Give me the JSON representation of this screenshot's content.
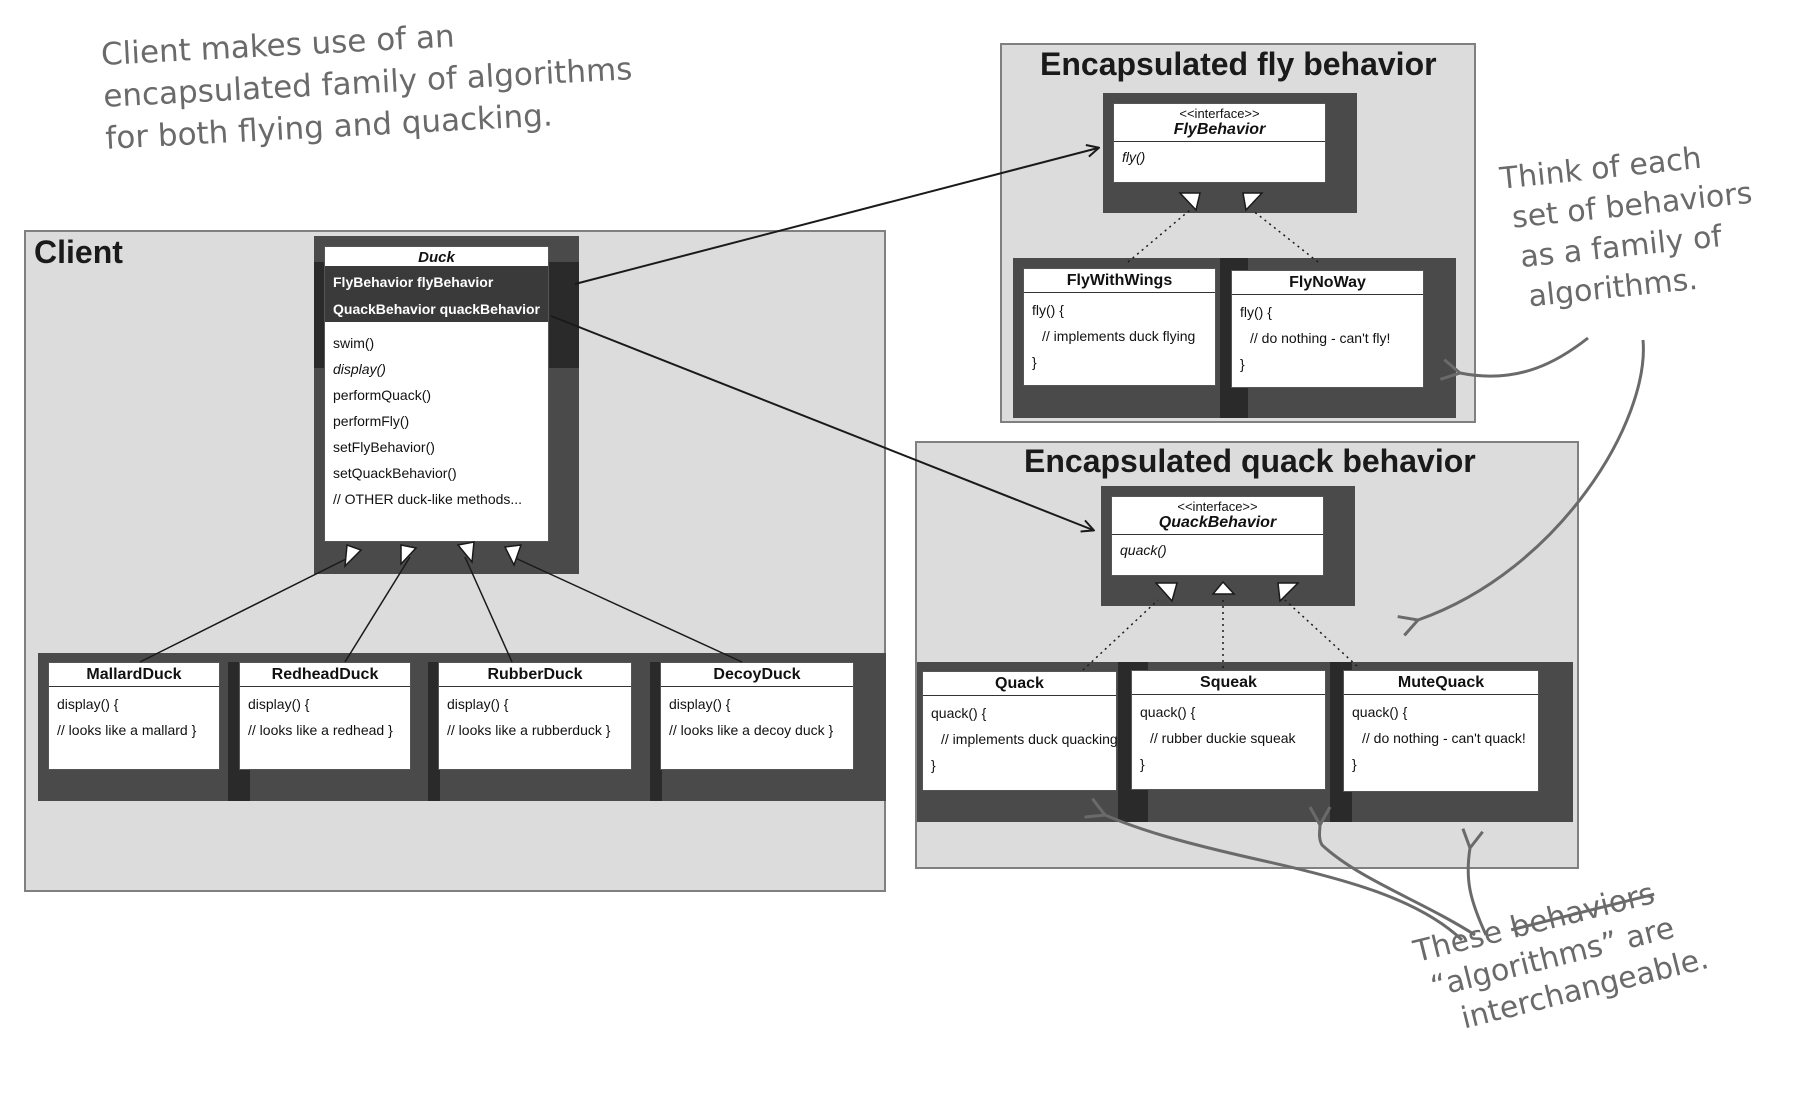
{
  "regions": {
    "client": "Client",
    "fly": "Encapsulated fly behavior",
    "quack": "Encapsulated quack behavior"
  },
  "duck": {
    "name": "Duck",
    "fields": [
      "FlyBehavior flyBehavior",
      "QuackBehavior quackBehavior"
    ],
    "methods": [
      "swim()",
      "display()",
      "performQuack()",
      "performFly()",
      "setFlyBehavior()",
      "setQuackBehavior()",
      "// OTHER duck-like methods..."
    ]
  },
  "subclasses": [
    {
      "name": "MallardDuck",
      "lines": [
        "display() {",
        "// looks like a mallard }"
      ]
    },
    {
      "name": "RedheadDuck",
      "lines": [
        "display() {",
        "// looks like a redhead }"
      ]
    },
    {
      "name": "RubberDuck",
      "lines": [
        "display() {",
        "// looks like a rubberduck }"
      ]
    },
    {
      "name": "DecoyDuck",
      "lines": [
        "display() {",
        "// looks like a decoy duck }"
      ]
    }
  ],
  "fly_interface": {
    "stereotype": "<<interface>>",
    "name": "FlyBehavior",
    "method": "fly()"
  },
  "fly_impls": [
    {
      "name": "FlyWithWings",
      "lines": [
        "fly() {",
        "// implements duck flying",
        "}"
      ]
    },
    {
      "name": "FlyNoWay",
      "lines": [
        "fly() {",
        "// do nothing - can't fly!",
        "}"
      ]
    }
  ],
  "quack_interface": {
    "stereotype": "<<interface>>",
    "name": "QuackBehavior",
    "method": "quack()"
  },
  "quack_impls": [
    {
      "name": "Quack",
      "lines": [
        "quack() {",
        "// implements duck quacking",
        "}"
      ]
    },
    {
      "name": "Squeak",
      "lines": [
        "quack() {",
        "// rubber duckie squeak",
        "}"
      ]
    },
    {
      "name": "MuteQuack",
      "lines": [
        "quack() {",
        "// do nothing - can't quack!",
        "}"
      ]
    }
  ],
  "annotations": {
    "client_note": [
      "Client makes use of an",
      "encapsulated family of algorithms",
      "for both flying and quacking."
    ],
    "family_note": [
      "Think of each",
      "set of behaviors",
      "as a family of",
      "algorithms."
    ],
    "interchange_note": {
      "line1_prefix": "These",
      "line1_struck": "behaviors",
      "line2": "“algorithms” are",
      "line3": "interchangeable."
    }
  },
  "colors": {
    "region_fill": "#dcdcdd",
    "shadow": "#4a4a4a",
    "handwriting": "#6a6a6a",
    "line": "#1a1a1a"
  }
}
